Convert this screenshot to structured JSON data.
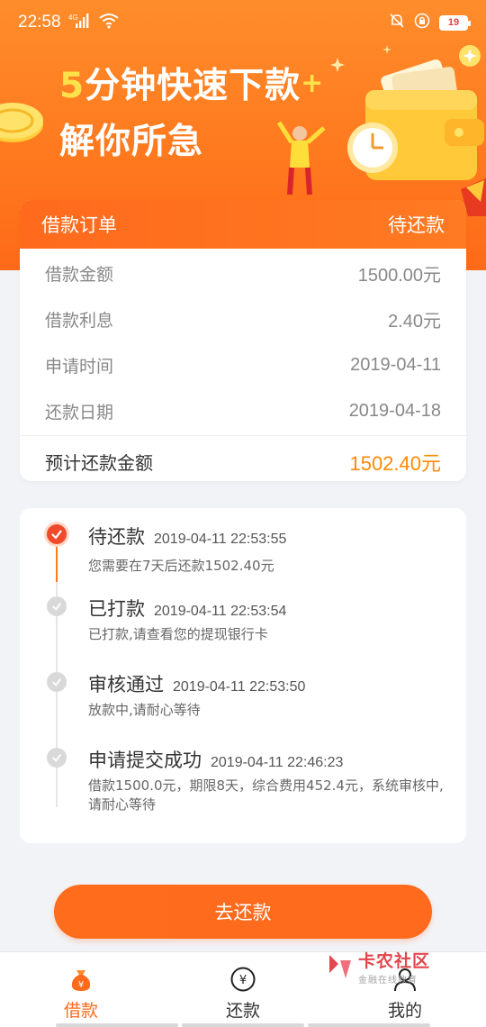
{
  "status_bar": {
    "time": "22:58",
    "network": "4G",
    "battery": "19"
  },
  "hero": {
    "slogan_digit": "5",
    "slogan_line1_rest": "分钟快速下款",
    "slogan_plus": "+",
    "slogan_line2": "解你所急"
  },
  "order": {
    "title": "借款订单",
    "status": "待还款",
    "rows": [
      {
        "label": "借款金额",
        "value": "1500.00元"
      },
      {
        "label": "借款利息",
        "value": "2.40元"
      },
      {
        "label": "申请时间",
        "value": "2019-04-11"
      },
      {
        "label": "还款日期",
        "value": "2019-04-18"
      }
    ],
    "total_label": "预计还款金额",
    "total_value": "1502.40元"
  },
  "timeline": [
    {
      "title": "待还款",
      "time": "2019-04-11 22:53:55",
      "desc": "您需要在7天后还款1502.40元",
      "active": true
    },
    {
      "title": "已打款",
      "time": "2019-04-11 22:53:54",
      "desc": "已打款,请查看您的提现银行卡",
      "active": false
    },
    {
      "title": "审核通过",
      "time": "2019-04-11 22:53:50",
      "desc": "放款中,请耐心等待",
      "active": false
    },
    {
      "title": "申请提交成功",
      "time": "2019-04-11 22:46:23",
      "desc": "借款1500.0元，期限8天，综合费用452.4元，系统审核中,请耐心等待",
      "active": false
    }
  ],
  "action": {
    "repay_label": "去还款"
  },
  "nav": {
    "items": [
      {
        "label": "借款",
        "icon": "money-bag-icon",
        "active": true
      },
      {
        "label": "还款",
        "icon": "yen-circle-icon",
        "active": false
      },
      {
        "label": "我的",
        "icon": "user-icon",
        "active": false
      }
    ]
  },
  "watermark": {
    "title": "卡农社区",
    "subtitle": "金融在线教育"
  },
  "colors": {
    "accent": "#ff6a1c",
    "total_amount": "#ff8a00",
    "timeline_active": "#f04a2a"
  }
}
